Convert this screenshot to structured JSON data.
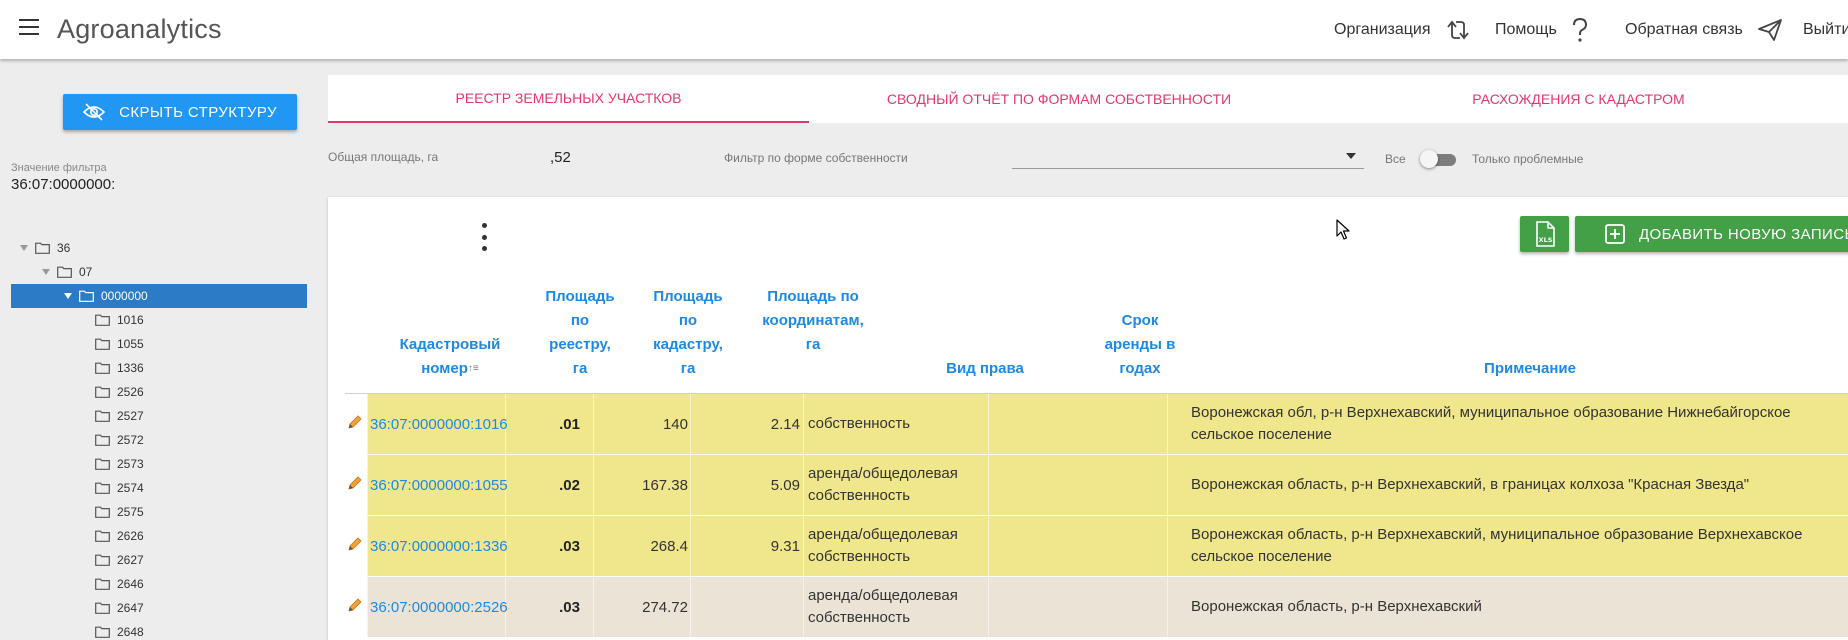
{
  "app": {
    "title": "Agroanalytics",
    "nav": {
      "organization": "Организация",
      "help": "Помощь",
      "feedback": "Обратная связь",
      "exit": "Выйти"
    }
  },
  "sidebar": {
    "hide_button": "СКРЫТЬ СТРУКТУРУ",
    "filter_label": "Значение фильтра",
    "filter_value": "36:07:0000000:",
    "tree": [
      {
        "label": "36",
        "level": 0,
        "expanded": true,
        "selected": false
      },
      {
        "label": "07",
        "level": 1,
        "expanded": true,
        "selected": false
      },
      {
        "label": "0000000",
        "level": 2,
        "expanded": true,
        "selected": true
      },
      {
        "label": "1016",
        "level": 3,
        "expanded": false,
        "selected": false
      },
      {
        "label": "1055",
        "level": 3,
        "expanded": false,
        "selected": false
      },
      {
        "label": "1336",
        "level": 3,
        "expanded": false,
        "selected": false
      },
      {
        "label": "2526",
        "level": 3,
        "expanded": false,
        "selected": false
      },
      {
        "label": "2527",
        "level": 3,
        "expanded": false,
        "selected": false
      },
      {
        "label": "2572",
        "level": 3,
        "expanded": false,
        "selected": false
      },
      {
        "label": "2573",
        "level": 3,
        "expanded": false,
        "selected": false
      },
      {
        "label": "2574",
        "level": 3,
        "expanded": false,
        "selected": false
      },
      {
        "label": "2575",
        "level": 3,
        "expanded": false,
        "selected": false
      },
      {
        "label": "2626",
        "level": 3,
        "expanded": false,
        "selected": false
      },
      {
        "label": "2627",
        "level": 3,
        "expanded": false,
        "selected": false
      },
      {
        "label": "2646",
        "level": 3,
        "expanded": false,
        "selected": false
      },
      {
        "label": "2647",
        "level": 3,
        "expanded": false,
        "selected": false
      },
      {
        "label": "2648",
        "level": 3,
        "expanded": false,
        "selected": false
      }
    ]
  },
  "tabs": [
    {
      "label": "Реестр земельных участков",
      "active": true
    },
    {
      "label": "Сводный отчёт по формам собственности",
      "active": false
    },
    {
      "label": "Расхождения с кадастром",
      "active": false
    }
  ],
  "filters": {
    "total_area_label": "Общая площадь, га",
    "total_area_value": ",52",
    "ownership_filter_label": "Фильтр по форме собственности",
    "ownership_filter_value": "",
    "toggle_all_label": "Все",
    "toggle_problem_label": "Только проблемные",
    "toggle_on": false
  },
  "toolbar": {
    "xls_label": "XLS",
    "add_label": "ДОБАВИТЬ НОВУЮ ЗАПИСЬ"
  },
  "table": {
    "columns": {
      "cadastral": "Кадастровый номер",
      "area_registry": "Площадь по реестру, га",
      "area_cadastre": "Площадь по кадастру, га",
      "area_coords": "Площадь по координатам, га",
      "right_type": "Вид права",
      "lease_term": "Срок аренды в годах",
      "note": "Примечание"
    },
    "sort_indicator": "↑≡",
    "rows": [
      {
        "cadastral": "36:07:0000000:1016",
        "area_registry": ".01",
        "area_cadastre": "140",
        "area_coords": "2.14",
        "right_type": "собственность",
        "lease_term": "",
        "note": "Воронежская обл, р-н Верхнехавский, муниципальное образование Нижнебайгорское сельское поселение",
        "bg": "#f0e68c"
      },
      {
        "cadastral": "36:07:0000000:1055",
        "area_registry": ".02",
        "area_cadastre": "167.38",
        "area_coords": "5.09",
        "right_type": "аренда/общедолевая собственность",
        "lease_term": "",
        "note": "Воронежская область, р-н Верхнехавский, в границах колхоза \"Красная Звезда\"",
        "bg": "#f0e68c"
      },
      {
        "cadastral": "36:07:0000000:1336",
        "area_registry": ".03",
        "area_cadastre": "268.4",
        "area_coords": "9.31",
        "right_type": "аренда/общедолевая собственность",
        "lease_term": "",
        "note": "Воронежская область, р-н Верхнехавский, муниципальное образование Верхнехавское сельское поселение",
        "bg": "#f0e68c"
      },
      {
        "cadastral": "36:07:0000000:2526",
        "area_registry": ".03",
        "area_cadastre": "274.72",
        "area_coords": "",
        "right_type": "аренда/общедолевая собственность",
        "lease_term": "",
        "note": "Воронежская область, р-н Верхнехавский",
        "bg": "#ebe4d6"
      }
    ]
  }
}
